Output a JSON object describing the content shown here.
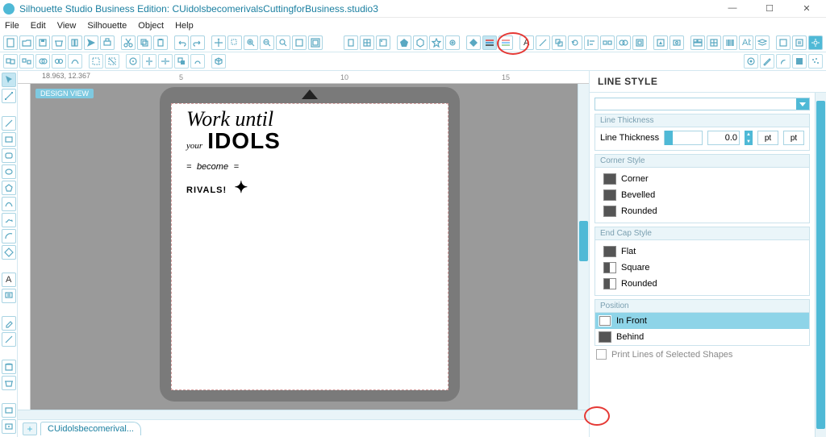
{
  "app": {
    "title": "Silhouette Studio Business Edition: CUidolsbecomerivalsCuttingforBusiness.studio3"
  },
  "menu": {
    "items": [
      "File",
      "Edit",
      "View",
      "Silhouette",
      "Object",
      "Help"
    ]
  },
  "canvas": {
    "coords": "18.963, 12.367",
    "design_tag": "DESIGN VIEW",
    "ruler_marks": [
      "5",
      "10",
      "15"
    ]
  },
  "artwork": {
    "line1": "Work until",
    "line2_script": "your",
    "line2_bold": "IDOLS",
    "line3_pre": "=",
    "line3": "become",
    "line3_post": "=",
    "line4": "RIVALS!"
  },
  "tab": {
    "label": "CUidolsbecomerival..."
  },
  "panel": {
    "title": "LINE STYLE",
    "line_thickness": {
      "header": "Line Thickness",
      "label": "Line Thickness",
      "value": "0.0",
      "unit1": "pt",
      "unit2": "pt"
    },
    "corner": {
      "header": "Corner Style",
      "options": [
        "Corner",
        "Bevelled",
        "Rounded"
      ]
    },
    "endcap": {
      "header": "End Cap Style",
      "options": [
        "Flat",
        "Square",
        "Rounded"
      ]
    },
    "position": {
      "header": "Position",
      "options": [
        "In Front",
        "Behind"
      ],
      "selected": 0
    },
    "print_lines": "Print Lines of Selected Shapes"
  }
}
